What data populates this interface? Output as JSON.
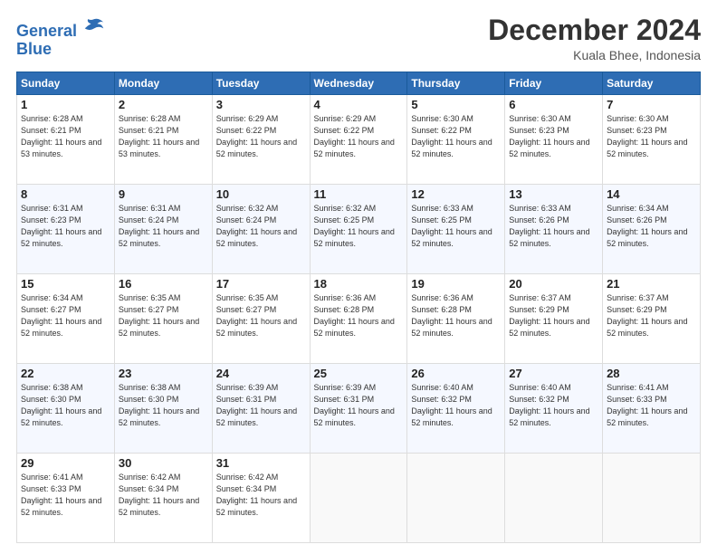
{
  "header": {
    "logo_line1": "General",
    "logo_line2": "Blue",
    "month_title": "December 2024",
    "location": "Kuala Bhee, Indonesia"
  },
  "days_of_week": [
    "Sunday",
    "Monday",
    "Tuesday",
    "Wednesday",
    "Thursday",
    "Friday",
    "Saturday"
  ],
  "weeks": [
    [
      {
        "day": "1",
        "sunrise": "Sunrise: 6:28 AM",
        "sunset": "Sunset: 6:21 PM",
        "daylight": "Daylight: 11 hours and 53 minutes."
      },
      {
        "day": "2",
        "sunrise": "Sunrise: 6:28 AM",
        "sunset": "Sunset: 6:21 PM",
        "daylight": "Daylight: 11 hours and 53 minutes."
      },
      {
        "day": "3",
        "sunrise": "Sunrise: 6:29 AM",
        "sunset": "Sunset: 6:22 PM",
        "daylight": "Daylight: 11 hours and 52 minutes."
      },
      {
        "day": "4",
        "sunrise": "Sunrise: 6:29 AM",
        "sunset": "Sunset: 6:22 PM",
        "daylight": "Daylight: 11 hours and 52 minutes."
      },
      {
        "day": "5",
        "sunrise": "Sunrise: 6:30 AM",
        "sunset": "Sunset: 6:22 PM",
        "daylight": "Daylight: 11 hours and 52 minutes."
      },
      {
        "day": "6",
        "sunrise": "Sunrise: 6:30 AM",
        "sunset": "Sunset: 6:23 PM",
        "daylight": "Daylight: 11 hours and 52 minutes."
      },
      {
        "day": "7",
        "sunrise": "Sunrise: 6:30 AM",
        "sunset": "Sunset: 6:23 PM",
        "daylight": "Daylight: 11 hours and 52 minutes."
      }
    ],
    [
      {
        "day": "8",
        "sunrise": "Sunrise: 6:31 AM",
        "sunset": "Sunset: 6:23 PM",
        "daylight": "Daylight: 11 hours and 52 minutes."
      },
      {
        "day": "9",
        "sunrise": "Sunrise: 6:31 AM",
        "sunset": "Sunset: 6:24 PM",
        "daylight": "Daylight: 11 hours and 52 minutes."
      },
      {
        "day": "10",
        "sunrise": "Sunrise: 6:32 AM",
        "sunset": "Sunset: 6:24 PM",
        "daylight": "Daylight: 11 hours and 52 minutes."
      },
      {
        "day": "11",
        "sunrise": "Sunrise: 6:32 AM",
        "sunset": "Sunset: 6:25 PM",
        "daylight": "Daylight: 11 hours and 52 minutes."
      },
      {
        "day": "12",
        "sunrise": "Sunrise: 6:33 AM",
        "sunset": "Sunset: 6:25 PM",
        "daylight": "Daylight: 11 hours and 52 minutes."
      },
      {
        "day": "13",
        "sunrise": "Sunrise: 6:33 AM",
        "sunset": "Sunset: 6:26 PM",
        "daylight": "Daylight: 11 hours and 52 minutes."
      },
      {
        "day": "14",
        "sunrise": "Sunrise: 6:34 AM",
        "sunset": "Sunset: 6:26 PM",
        "daylight": "Daylight: 11 hours and 52 minutes."
      }
    ],
    [
      {
        "day": "15",
        "sunrise": "Sunrise: 6:34 AM",
        "sunset": "Sunset: 6:27 PM",
        "daylight": "Daylight: 11 hours and 52 minutes."
      },
      {
        "day": "16",
        "sunrise": "Sunrise: 6:35 AM",
        "sunset": "Sunset: 6:27 PM",
        "daylight": "Daylight: 11 hours and 52 minutes."
      },
      {
        "day": "17",
        "sunrise": "Sunrise: 6:35 AM",
        "sunset": "Sunset: 6:27 PM",
        "daylight": "Daylight: 11 hours and 52 minutes."
      },
      {
        "day": "18",
        "sunrise": "Sunrise: 6:36 AM",
        "sunset": "Sunset: 6:28 PM",
        "daylight": "Daylight: 11 hours and 52 minutes."
      },
      {
        "day": "19",
        "sunrise": "Sunrise: 6:36 AM",
        "sunset": "Sunset: 6:28 PM",
        "daylight": "Daylight: 11 hours and 52 minutes."
      },
      {
        "day": "20",
        "sunrise": "Sunrise: 6:37 AM",
        "sunset": "Sunset: 6:29 PM",
        "daylight": "Daylight: 11 hours and 52 minutes."
      },
      {
        "day": "21",
        "sunrise": "Sunrise: 6:37 AM",
        "sunset": "Sunset: 6:29 PM",
        "daylight": "Daylight: 11 hours and 52 minutes."
      }
    ],
    [
      {
        "day": "22",
        "sunrise": "Sunrise: 6:38 AM",
        "sunset": "Sunset: 6:30 PM",
        "daylight": "Daylight: 11 hours and 52 minutes."
      },
      {
        "day": "23",
        "sunrise": "Sunrise: 6:38 AM",
        "sunset": "Sunset: 6:30 PM",
        "daylight": "Daylight: 11 hours and 52 minutes."
      },
      {
        "day": "24",
        "sunrise": "Sunrise: 6:39 AM",
        "sunset": "Sunset: 6:31 PM",
        "daylight": "Daylight: 11 hours and 52 minutes."
      },
      {
        "day": "25",
        "sunrise": "Sunrise: 6:39 AM",
        "sunset": "Sunset: 6:31 PM",
        "daylight": "Daylight: 11 hours and 52 minutes."
      },
      {
        "day": "26",
        "sunrise": "Sunrise: 6:40 AM",
        "sunset": "Sunset: 6:32 PM",
        "daylight": "Daylight: 11 hours and 52 minutes."
      },
      {
        "day": "27",
        "sunrise": "Sunrise: 6:40 AM",
        "sunset": "Sunset: 6:32 PM",
        "daylight": "Daylight: 11 hours and 52 minutes."
      },
      {
        "day": "28",
        "sunrise": "Sunrise: 6:41 AM",
        "sunset": "Sunset: 6:33 PM",
        "daylight": "Daylight: 11 hours and 52 minutes."
      }
    ],
    [
      {
        "day": "29",
        "sunrise": "Sunrise: 6:41 AM",
        "sunset": "Sunset: 6:33 PM",
        "daylight": "Daylight: 11 hours and 52 minutes."
      },
      {
        "day": "30",
        "sunrise": "Sunrise: 6:42 AM",
        "sunset": "Sunset: 6:34 PM",
        "daylight": "Daylight: 11 hours and 52 minutes."
      },
      {
        "day": "31",
        "sunrise": "Sunrise: 6:42 AM",
        "sunset": "Sunset: 6:34 PM",
        "daylight": "Daylight: 11 hours and 52 minutes."
      },
      null,
      null,
      null,
      null
    ]
  ]
}
